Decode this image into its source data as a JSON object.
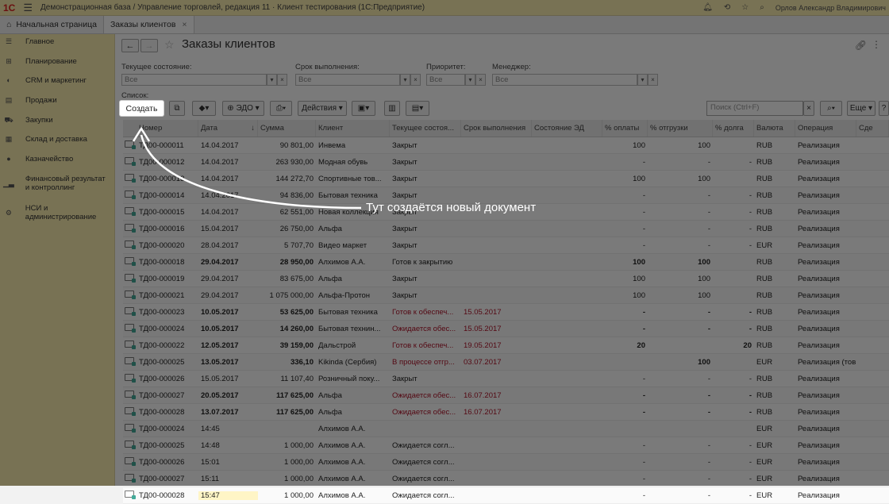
{
  "titlebar": {
    "logo": "1С",
    "title": "Демонстрационная база / Управление торговлей, редакция 11 · Клиент тестирования (1С:Предприятие)",
    "user": "Орлов Александр Владимирович"
  },
  "tabs": {
    "home": "Начальная страница",
    "active": "Заказы клиентов"
  },
  "sidebar": {
    "items": [
      {
        "label": "Главное",
        "icon": "menu-icon"
      },
      {
        "label": "Планирование",
        "icon": "planning-icon"
      },
      {
        "label": "CRM и маркетинг",
        "icon": "crm-icon"
      },
      {
        "label": "Продажи",
        "icon": "sales-icon"
      },
      {
        "label": "Закупки",
        "icon": "cart-icon"
      },
      {
        "label": "Склад и доставка",
        "icon": "warehouse-icon"
      },
      {
        "label": "Казначейство",
        "icon": "treasury-icon"
      },
      {
        "label": "Финансовый результат и контроллинг",
        "icon": "chart-icon"
      },
      {
        "label": "НСИ и администрирование",
        "icon": "gear-icon"
      }
    ]
  },
  "page": {
    "title": "Заказы клиентов"
  },
  "filters": {
    "state_label": "Текущее состояние:",
    "state_value": "Все",
    "due_label": "Срок выполнения:",
    "due_value": "Все",
    "priority_label": "Приоритет:",
    "priority_value": "Все",
    "manager_label": "Менеджер:",
    "manager_value": "Все"
  },
  "list_label": "Список:",
  "toolbar": {
    "create": "Создать",
    "edo": "ЭДО",
    "actions": "Действия",
    "search_placeholder": "Поиск (Ctrl+F)",
    "more": "Еще"
  },
  "columns": [
    "Номер",
    "Дата",
    "Сумма",
    "Клиент",
    "Текущее состоя...",
    "Срок выполнения",
    "Состояние ЭД",
    "% оплаты",
    "% отгрузки",
    "% долга",
    "Валюта",
    "Операция",
    "Сде"
  ],
  "rows": [
    {
      "num": "ТД00-000011",
      "date": "14.04.2017",
      "sum": "90 801,00",
      "client": "Инвема",
      "state": "Закрыт",
      "due": "",
      "ed": "",
      "pay": "100",
      "ship": "100",
      "debt": "",
      "cur": "RUB",
      "op": "Реализация",
      "bold": false,
      "red": false
    },
    {
      "num": "ТД00-000012",
      "date": "14.04.2017",
      "sum": "263 930,00",
      "client": "Модная обувь",
      "state": "Закрыт",
      "due": "",
      "ed": "",
      "pay": "-",
      "ship": "-",
      "debt": "-",
      "cur": "RUB",
      "op": "Реализация",
      "bold": false,
      "red": false
    },
    {
      "num": "ТД00-000013",
      "date": "14.04.2017",
      "sum": "144 272,70",
      "client": "Спортивные тов...",
      "state": "Закрыт",
      "due": "",
      "ed": "",
      "pay": "100",
      "ship": "100",
      "debt": "",
      "cur": "RUB",
      "op": "Реализация",
      "bold": false,
      "red": false
    },
    {
      "num": "ТД00-000014",
      "date": "14.04.2017",
      "sum": "94 836,00",
      "client": "Бытовая техника",
      "state": "Закрыт",
      "due": "",
      "ed": "",
      "pay": "-",
      "ship": "-",
      "debt": "-",
      "cur": "RUB",
      "op": "Реализация",
      "bold": false,
      "red": false
    },
    {
      "num": "ТД00-000015",
      "date": "14.04.2017",
      "sum": "62 551,00",
      "client": "Новая коллекция",
      "state": "Закрыт",
      "due": "",
      "ed": "",
      "pay": "-",
      "ship": "-",
      "debt": "-",
      "cur": "RUB",
      "op": "Реализация",
      "bold": false,
      "red": false
    },
    {
      "num": "ТД00-000016",
      "date": "15.04.2017",
      "sum": "26 750,00",
      "client": "Альфа",
      "state": "Закрыт",
      "due": "",
      "ed": "",
      "pay": "-",
      "ship": "-",
      "debt": "-",
      "cur": "RUB",
      "op": "Реализация",
      "bold": false,
      "red": false
    },
    {
      "num": "ТД00-000020",
      "date": "28.04.2017",
      "sum": "5 707,70",
      "client": "Видео маркет",
      "state": "Закрыт",
      "due": "",
      "ed": "",
      "pay": "-",
      "ship": "-",
      "debt": "-",
      "cur": "EUR",
      "op": "Реализация",
      "bold": false,
      "red": false
    },
    {
      "num": "ТД00-000018",
      "date": "29.04.2017",
      "sum": "28 950,00",
      "client": "Алхимов А.А.",
      "state": "Готов к закрытию",
      "due": "",
      "ed": "",
      "pay": "100",
      "ship": "100",
      "debt": "",
      "cur": "RUB",
      "op": "Реализация",
      "bold": true,
      "red": false
    },
    {
      "num": "ТД00-000019",
      "date": "29.04.2017",
      "sum": "83 675,00",
      "client": "Альфа",
      "state": "Закрыт",
      "due": "",
      "ed": "",
      "pay": "100",
      "ship": "100",
      "debt": "",
      "cur": "RUB",
      "op": "Реализация",
      "bold": false,
      "red": false
    },
    {
      "num": "ТД00-000021",
      "date": "29.04.2017",
      "sum": "1 075 000,00",
      "client": "Альфа-Протон",
      "state": "Закрыт",
      "due": "",
      "ed": "",
      "pay": "100",
      "ship": "100",
      "debt": "",
      "cur": "RUB",
      "op": "Реализация",
      "bold": false,
      "red": false
    },
    {
      "num": "ТД00-000023",
      "date": "10.05.2017",
      "sum": "53 625,00",
      "client": "Бытовая техника",
      "state": "Готов к обеспеч...",
      "due": "15.05.2017",
      "ed": "",
      "pay": "-",
      "ship": "-",
      "debt": "-",
      "cur": "RUB",
      "op": "Реализация",
      "bold": true,
      "red": true
    },
    {
      "num": "ТД00-000024",
      "date": "10.05.2017",
      "sum": "14 260,00",
      "client": "Бытовая технин...",
      "state": "Ожидается обес...",
      "due": "15.05.2017",
      "ed": "",
      "pay": "-",
      "ship": "-",
      "debt": "-",
      "cur": "RUB",
      "op": "Реализация",
      "bold": true,
      "red": true
    },
    {
      "num": "ТД00-000022",
      "date": "12.05.2017",
      "sum": "39 159,00",
      "client": "Дальстрой",
      "state": "Готов к обеспеч...",
      "due": "19.05.2017",
      "ed": "",
      "pay": "20",
      "ship": "",
      "debt": "20",
      "cur": "RUB",
      "op": "Реализация",
      "bold": true,
      "red": true
    },
    {
      "num": "ТД00-000025",
      "date": "13.05.2017",
      "sum": "336,10",
      "client": "Kikinda (Сербия)",
      "state": "В процессе отгр...",
      "due": "03.07.2017",
      "ed": "",
      "pay": "",
      "ship": "100",
      "debt": "",
      "cur": "EUR",
      "op": "Реализация (тов...",
      "bold": true,
      "red": true
    },
    {
      "num": "ТД00-000026",
      "date": "15.05.2017",
      "sum": "11 107,40",
      "client": "Розничный поку...",
      "state": "Закрыт",
      "due": "",
      "ed": "",
      "pay": "-",
      "ship": "-",
      "debt": "-",
      "cur": "RUB",
      "op": "Реализация",
      "bold": false,
      "red": false
    },
    {
      "num": "ТД00-000027",
      "date": "20.05.2017",
      "sum": "117 625,00",
      "client": "Альфа",
      "state": "Ожидается обес...",
      "due": "16.07.2017",
      "ed": "",
      "pay": "-",
      "ship": "-",
      "debt": "-",
      "cur": "RUB",
      "op": "Реализация",
      "bold": true,
      "red": true
    },
    {
      "num": "ТД00-000028",
      "date": "13.07.2017",
      "sum": "117 625,00",
      "client": "Альфа",
      "state": "Ожидается обес...",
      "due": "16.07.2017",
      "ed": "",
      "pay": "-",
      "ship": "-",
      "debt": "-",
      "cur": "RUB",
      "op": "Реализация",
      "bold": true,
      "red": true
    },
    {
      "num": "ТД00-000024",
      "date": "14:45",
      "sum": "",
      "client": "Алхимов А.А.",
      "state": "",
      "due": "",
      "ed": "",
      "pay": "",
      "ship": "",
      "debt": "",
      "cur": "EUR",
      "op": "Реализация",
      "bold": false,
      "red": false
    },
    {
      "num": "ТД00-000025",
      "date": "14:48",
      "sum": "1 000,00",
      "client": "Алхимов А.А.",
      "state": "Ожидается согл...",
      "due": "",
      "ed": "",
      "pay": "-",
      "ship": "-",
      "debt": "-",
      "cur": "EUR",
      "op": "Реализация",
      "bold": false,
      "red": false
    },
    {
      "num": "ТД00-000026",
      "date": "15:01",
      "sum": "1 000,00",
      "client": "Алхимов А.А.",
      "state": "Ожидается согл...",
      "due": "",
      "ed": "",
      "pay": "-",
      "ship": "-",
      "debt": "-",
      "cur": "EUR",
      "op": "Реализация",
      "bold": false,
      "red": false
    },
    {
      "num": "ТД00-000027",
      "date": "15:11",
      "sum": "1 000,00",
      "client": "Алхимов А.А.",
      "state": "Ожидается согл...",
      "due": "",
      "ed": "",
      "pay": "-",
      "ship": "-",
      "debt": "-",
      "cur": "EUR",
      "op": "Реализация",
      "bold": false,
      "red": false
    },
    {
      "num": "ТД00-000028",
      "date": "15:47",
      "sum": "1 000,00",
      "client": "Алхимов А.А.",
      "state": "Ожидается согл...",
      "due": "",
      "ed": "",
      "pay": "-",
      "ship": "-",
      "debt": "-",
      "cur": "EUR",
      "op": "Реализация",
      "bold": false,
      "red": false
    }
  ],
  "annotation": "Тут создаётся новый документ",
  "colors": {
    "sidebar_bg": "#fbeeb0",
    "accent_red": "#b0142a",
    "overlay": "#000000"
  }
}
